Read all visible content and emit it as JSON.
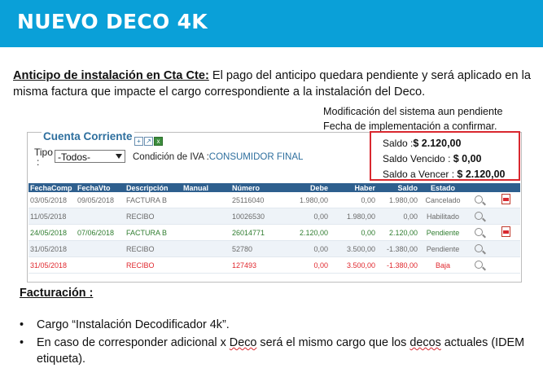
{
  "header": {
    "title": "NUEVO DECO 4K"
  },
  "intro": {
    "heading": "Anticipo de instalación en Cta Cte:",
    "text": " El pago del anticipo quedara pendiente y será aplicado en la misma factura que impacte el cargo correspondiente a la instalación del Deco."
  },
  "note": {
    "line1": "Modificación del sistema aun pendiente",
    "line2": "Fecha de implementación a confirmar."
  },
  "cuenta": {
    "title": "Cuenta Corriente",
    "tipo_label": "Tipo",
    "tipo_colon": ":",
    "tipo_value": "-Todos-",
    "iva_label": "Condición de IVA :",
    "iva_value": "CONSUMIDOR FINAL",
    "saldo_label": "Saldo :",
    "saldo_value": "$ 2.120,00",
    "vencido_label": "Saldo Vencido :",
    "vencido_value": "$ 0,00",
    "avencer_label": "Saldo a Vencer :",
    "avencer_value": "$ 2.120,00",
    "columns": [
      "FechaComp",
      "FechaVto",
      "Descripción",
      "Manual",
      "Número",
      "Debe",
      "Haber",
      "Saldo",
      "Estado"
    ],
    "rows": [
      {
        "fechacomp": "03/05/2018",
        "fechavto": "09/05/2018",
        "desc": "FACTURA B",
        "manual": "",
        "numero": "25116040",
        "debe": "1.980,00",
        "haber": "0,00",
        "saldo": "1.980,00",
        "estado": "Cancelado",
        "color": "#6b6b6b",
        "pdf": true
      },
      {
        "fechacomp": "11/05/2018",
        "fechavto": "",
        "desc": "RECIBO",
        "manual": "",
        "numero": "10026530",
        "debe": "0,00",
        "haber": "1.980,00",
        "saldo": "0,00",
        "estado": "Habilitado",
        "color": "#6b6b6b",
        "pdf": false
      },
      {
        "fechacomp": "24/05/2018",
        "fechavto": "07/06/2018",
        "desc": "FACTURA B",
        "manual": "",
        "numero": "26014771",
        "debe": "2.120,00",
        "haber": "0,00",
        "saldo": "2.120,00",
        "estado": "Pendiente",
        "color": "#2f7d2f",
        "pdf": true
      },
      {
        "fechacomp": "31/05/2018",
        "fechavto": "",
        "desc": "RECIBO",
        "manual": "",
        "numero": "52780",
        "debe": "0,00",
        "haber": "3.500,00",
        "saldo": "-1.380,00",
        "estado": "Pendiente",
        "color": "#6b6b6b",
        "pdf": false
      },
      {
        "fechacomp": "31/05/2018",
        "fechavto": "",
        "desc": "RECIBO",
        "manual": "",
        "numero": "127493",
        "debe": "0,00",
        "haber": "3.500,00",
        "saldo": "-1.380,00",
        "estado": "Baja",
        "color": "#e0282e",
        "pdf": false
      }
    ]
  },
  "facturacion": {
    "heading": "Facturación :",
    "bullet1": "Cargo “Instalación Decodificador 4k”.",
    "bullet2_pre": "En caso de corresponder adicional  x ",
    "bullet2_deco": "Deco",
    "bullet2_mid": "  será el mismo cargo que los ",
    "bullet2_decos": "decos",
    "bullet2_post": " actuales (IDEM etiqueta)."
  },
  "colors": {
    "header": "#0aa0d8",
    "table_header": "#2e5f8e",
    "highlight": "#d9282f",
    "link": "#2e6f9e"
  }
}
